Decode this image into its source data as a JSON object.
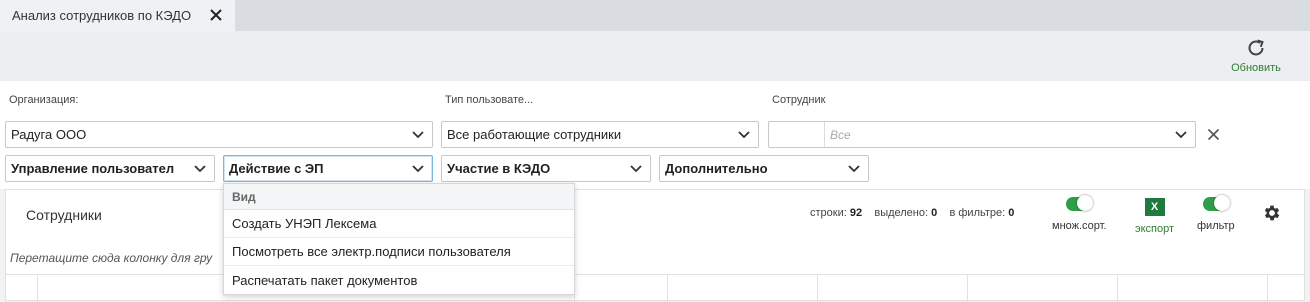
{
  "tab": {
    "title": "Анализ сотрудников по КЭДО"
  },
  "toolbar": {
    "refresh_label": "Обновить"
  },
  "filters": {
    "organization": {
      "label": "Организация:",
      "value": "Радуга ООО"
    },
    "user_type": {
      "label": "Тип пользовате...",
      "value": "Все работающие сотрудники"
    },
    "employee": {
      "label": "Сотрудник",
      "placeholder": "Все"
    },
    "group_user_mgmt": "Управление пользовател",
    "group_ep_action": "Действие с ЭП",
    "group_kedo": "Участие в КЭДО",
    "group_additional": "Дополнительно"
  },
  "dropdown": {
    "header": "Вид",
    "items": [
      "Создать УНЭП Лексема",
      "Посмотреть все электр.подписи пользователя",
      "Распечатать пакет документов"
    ]
  },
  "grid": {
    "title": "Сотрудники",
    "stats": {
      "rows_label": "строки:",
      "rows_value": "92",
      "selected_label": "выделено:",
      "selected_value": "0",
      "filtered_label": "в фильтре:",
      "filtered_value": "0"
    },
    "multisort_label": "множ.сорт.",
    "export_label": "экспорт",
    "export_icon_text": "X",
    "filter_label": "фильтр",
    "group_hint": "Перетащите сюда колонку для гру"
  },
  "colors": {
    "accent_green": "#2e7d32",
    "toggle_on": "#2e9e4a",
    "excel_green": "#1f7a3e"
  }
}
